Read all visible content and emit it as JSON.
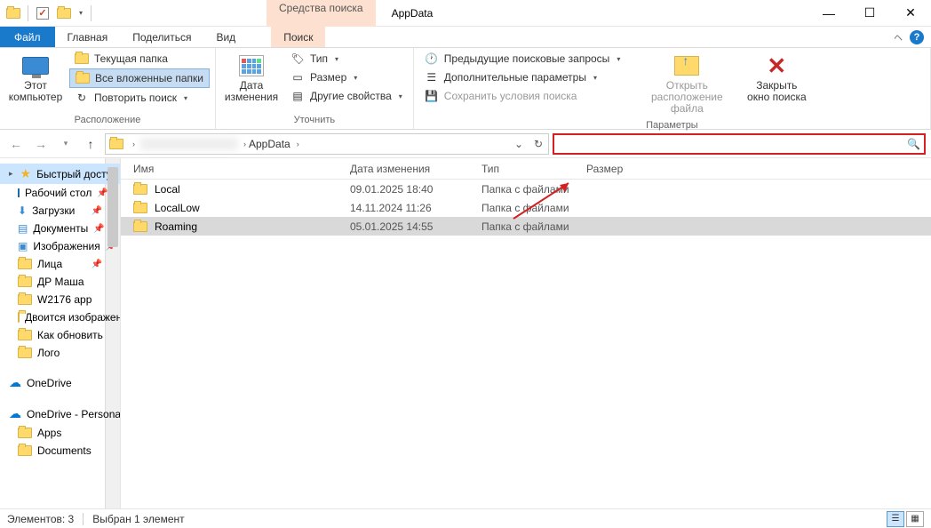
{
  "window": {
    "title": "AppData"
  },
  "search_tools": {
    "label": "Средства поиска",
    "tab": "Поиск"
  },
  "tabs": {
    "file": "Файл",
    "home": "Главная",
    "share": "Поделиться",
    "view": "Вид"
  },
  "ribbon": {
    "location": {
      "this_pc": "Этот\nкомпьютер",
      "current_folder": "Текущая папка",
      "all_subfolders": "Все вложенные папки",
      "search_again": "Повторить поиск",
      "group_label": "Расположение"
    },
    "refine": {
      "date_modified": "Дата\nизменения",
      "type": "Тип",
      "size": "Размер",
      "other_props": "Другие свойства",
      "group_label": "Уточнить"
    },
    "options": {
      "recent_searches": "Предыдущие поисковые запросы",
      "advanced_options": "Дополнительные параметры",
      "save_search": "Сохранить условия поиска",
      "open_location": "Открыть\nрасположение файла",
      "close_search": "Закрыть\nокно поиска",
      "group_label": "Параметры"
    }
  },
  "address": {
    "segment": "AppData"
  },
  "columns": {
    "name": "Имя",
    "date": "Дата изменения",
    "type": "Тип",
    "size": "Размер"
  },
  "rows": [
    {
      "name": "Local",
      "date": "09.01.2025 18:40",
      "type": "Папка с файлами",
      "selected": false
    },
    {
      "name": "LocalLow",
      "date": "14.11.2024 11:26",
      "type": "Папка с файлами",
      "selected": false
    },
    {
      "name": "Roaming",
      "date": "05.01.2025 14:55",
      "type": "Папка с файлами",
      "selected": true
    }
  ],
  "sidebar": {
    "quick_access": "Быстрый доступ",
    "items": [
      {
        "label": "Рабочий стол",
        "icon": "desktop",
        "pinned": true
      },
      {
        "label": "Загрузки",
        "icon": "download",
        "pinned": true
      },
      {
        "label": "Документы",
        "icon": "doc",
        "pinned": true
      },
      {
        "label": "Изображения",
        "icon": "pic",
        "pinned": true
      },
      {
        "label": "Лица",
        "icon": "folder",
        "pinned": true
      },
      {
        "label": "ДР Маша",
        "icon": "folder",
        "pinned": false
      },
      {
        "label": "W2176 app",
        "icon": "folder",
        "pinned": false
      },
      {
        "label": "Двоится изображение",
        "icon": "folder",
        "pinned": false
      },
      {
        "label": "Как обновить",
        "icon": "folder",
        "pinned": false
      },
      {
        "label": "Лого",
        "icon": "folder",
        "pinned": false
      }
    ],
    "onedrive1": "OneDrive",
    "onedrive2": "OneDrive - Personal",
    "od_items": [
      {
        "label": "Apps"
      },
      {
        "label": "Documents"
      }
    ]
  },
  "status": {
    "count": "Элементов: 3",
    "selected": "Выбран 1 элемент"
  }
}
